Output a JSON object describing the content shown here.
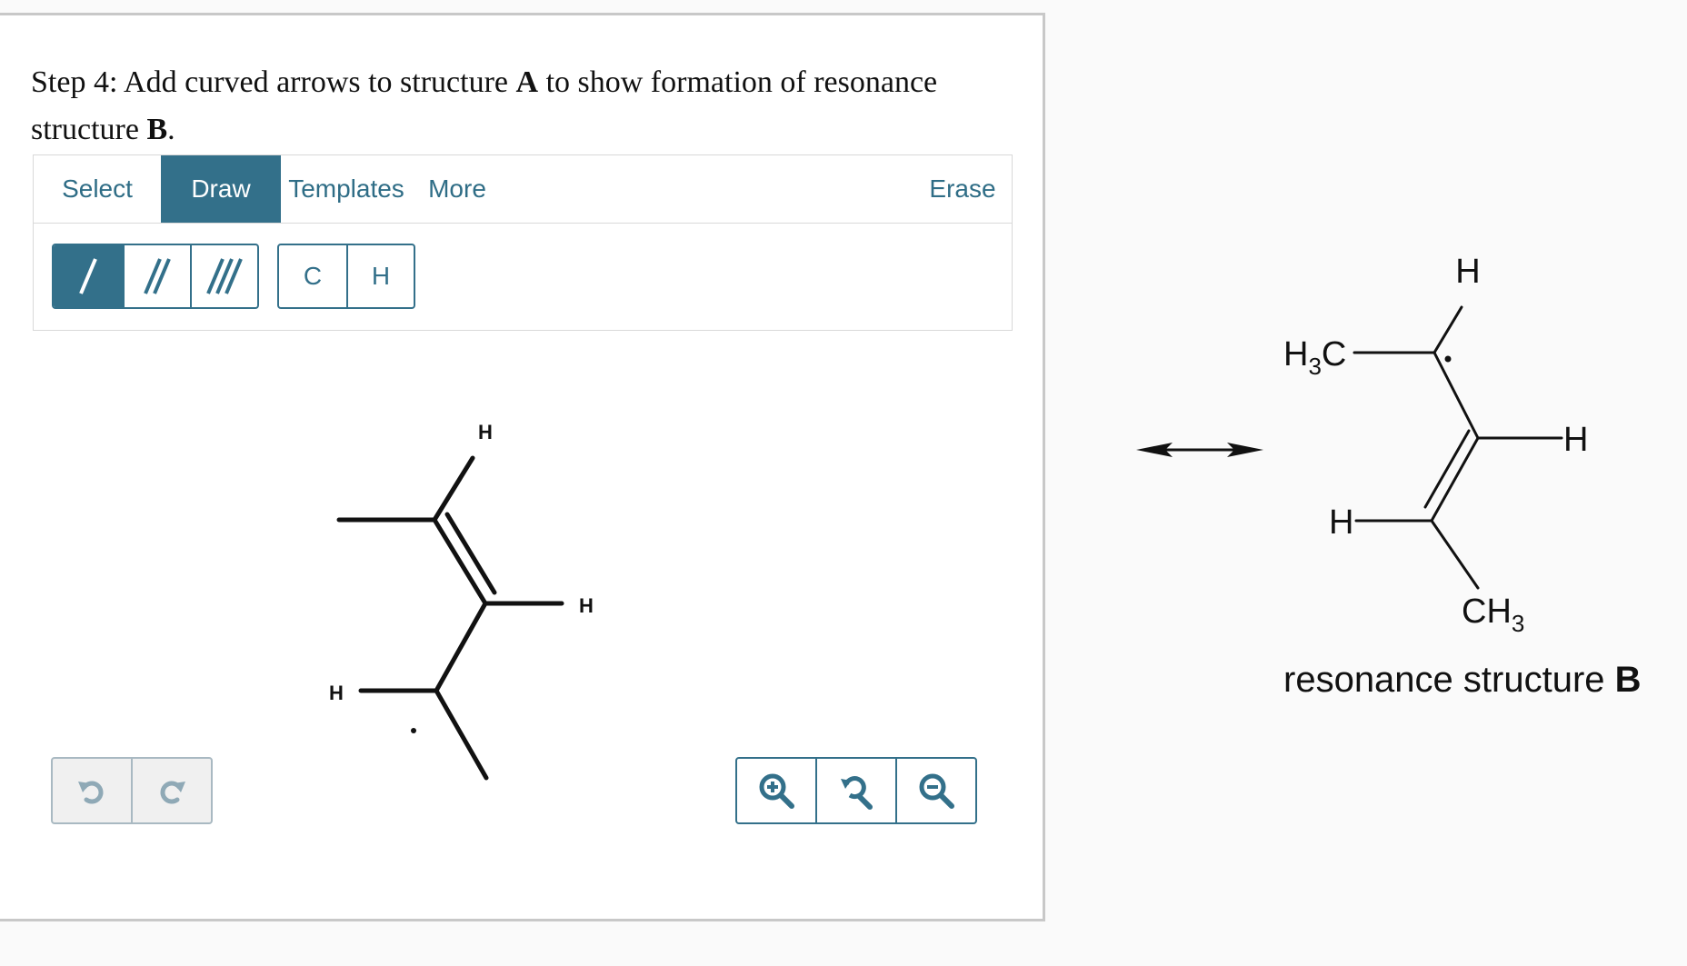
{
  "instruction": {
    "step": "Step 4:",
    "text_before": "Add curved arrows to structure",
    "struct_a": "A",
    "text_middle": "to show formation of resonance structure",
    "struct_b": "B",
    "text_end": "."
  },
  "tabs": {
    "select": "Select",
    "draw": "Draw",
    "templates": "Templates",
    "more": "More",
    "erase": "Erase",
    "active": "Draw"
  },
  "bond_tools": {
    "single": "single-bond",
    "double": "double-bond",
    "triple": "triple-bond",
    "active": "single-bond"
  },
  "atom_tools": {
    "carbon": "C",
    "hydrogen": "H"
  },
  "canvas_structure": {
    "h_top": "H",
    "h_right": "H",
    "h_left": "H"
  },
  "structure_b": {
    "h_top": "H",
    "ch3_left": "H3C",
    "h_right": "H",
    "h_left": "H",
    "ch3_bottom": "CH3",
    "caption_prefix": "resonance structure",
    "caption_letter": "B"
  },
  "icons": {
    "undo": "undo-icon",
    "redo": "redo-icon",
    "zoom_in": "zoom-in-icon",
    "zoom_reset": "zoom-reset-icon",
    "zoom_out": "zoom-out-icon",
    "resonance_arrow": "double-headed-arrow-icon"
  },
  "colors": {
    "accent": "#33708a",
    "bond": "#111111"
  }
}
